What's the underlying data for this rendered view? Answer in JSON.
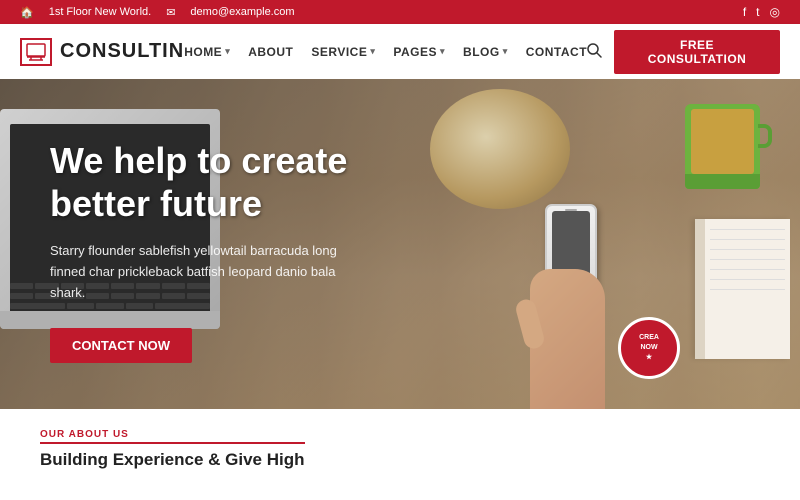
{
  "topbar": {
    "address": "1st Floor New World.",
    "email": "demo@example.com",
    "social": [
      "f",
      "t",
      "in"
    ]
  },
  "navbar": {
    "logo_text": "CONSULTIN",
    "links": [
      {
        "label": "HOME",
        "has_dropdown": true
      },
      {
        "label": "ABOUT",
        "has_dropdown": false
      },
      {
        "label": "SERVICE",
        "has_dropdown": true
      },
      {
        "label": "PAGES",
        "has_dropdown": true
      },
      {
        "label": "BLOG",
        "has_dropdown": true
      },
      {
        "label": "CONTACT",
        "has_dropdown": false
      }
    ],
    "cta_label": "Free Consultation"
  },
  "hero": {
    "title_line1": "We help to create",
    "title_line2": "better future",
    "subtitle": "Starry flounder sablefish yellowtail barracuda long finned char prickleback batfish leopard danio bala shark.",
    "cta_label": "Contact Now",
    "badge": "CREA\nNOW"
  },
  "below": {
    "section_label": "OUR ABOUT US",
    "heading": "Building Experience & Give High"
  }
}
